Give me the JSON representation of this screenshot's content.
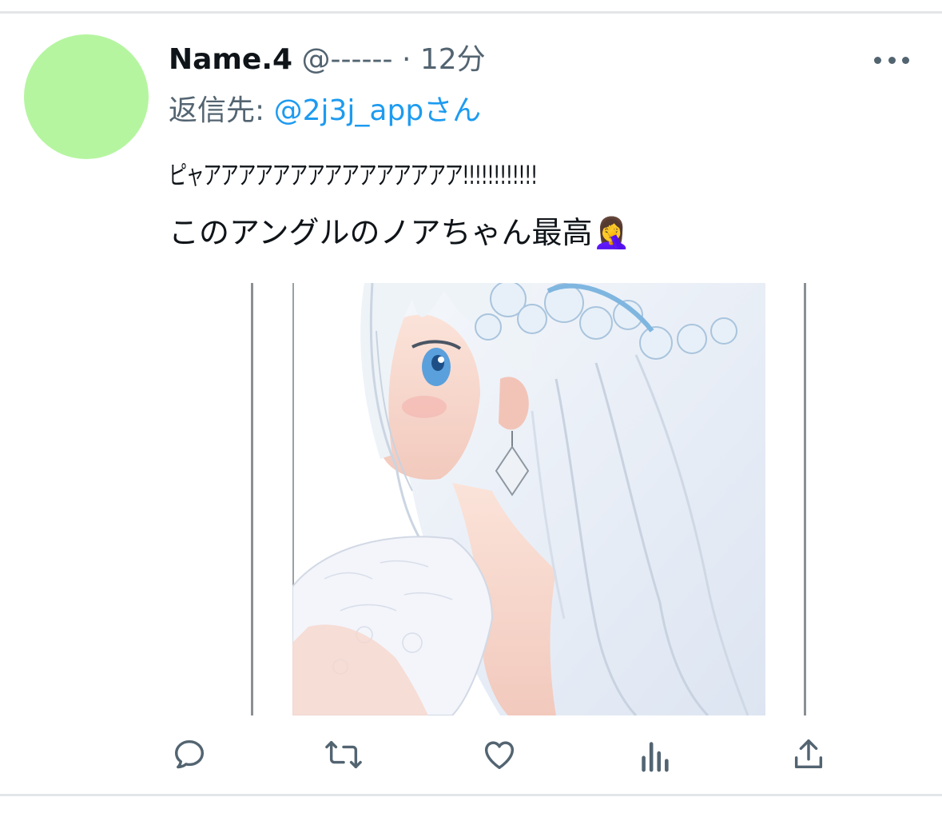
{
  "tweet": {
    "author_name": "Name.4",
    "handle": "@------",
    "separator": "·",
    "timestamp": "12分",
    "reply_label": "返信先:",
    "reply_target": "@2j3j_appさん",
    "text_line1": "ピャアアアアアアアアアアアアアアア!!!!!!!!!!!!",
    "text_line2": "このアングルのノアちゃん最高🤦‍♀️"
  },
  "avatar": {
    "color": "#b5f5a0"
  },
  "media": {
    "description": "anime girl illustration"
  },
  "actions": [
    "reply-icon",
    "retweet-icon",
    "like-icon",
    "views-icon",
    "share-icon"
  ],
  "colors": {
    "text_primary": "#0f1419",
    "text_secondary": "#536471",
    "link": "#1d9bf0",
    "icon": "#536471"
  }
}
